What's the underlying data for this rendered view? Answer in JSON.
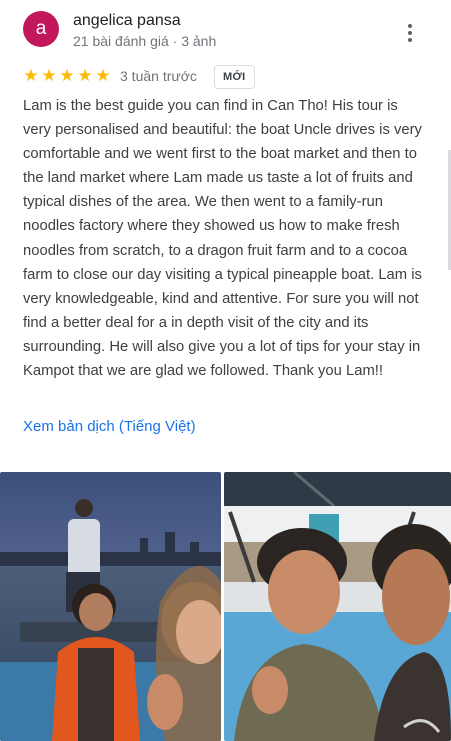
{
  "reviewer": {
    "avatar_letter": "a",
    "avatar_color": "#c2185b",
    "name": "angelica pansa",
    "meta": "21 bài đánh giá · 3 ảnh"
  },
  "rating": {
    "stars": 5,
    "max": 5,
    "star_glyph": "★",
    "star_color": "#fbbc04"
  },
  "posted": "3 tuần trước",
  "badge": "MỚI",
  "review_text": "Lam is the best guide you can find in Can Tho! His tour is very personalised and beautiful: the boat Uncle drives is very comfortable and we went first to the boat market and then to the land market where Lam made us taste a lot of fruits and typical dishes of the area. We then went to a family-run noodles factory where they showed us how to make fresh noodles from scratch, to a dragon fruit farm and to a cocoa farm to close our day visiting a typical pineapple boat. Lam is very knowledgeable, kind and attentive. For sure you will not find a better deal for a in depth visit of the city and its surrounding. He will also give you a lot of tips for your stay in Kampot that we are glad we followed. Thank you Lam!!",
  "translate_link": "Xem bản dịch (Tiếng Việt)",
  "icons": {
    "more": "more-vert-icon",
    "star": "star-icon"
  },
  "colors": {
    "link": "#1a73e8",
    "secondary_text": "#70757a"
  }
}
